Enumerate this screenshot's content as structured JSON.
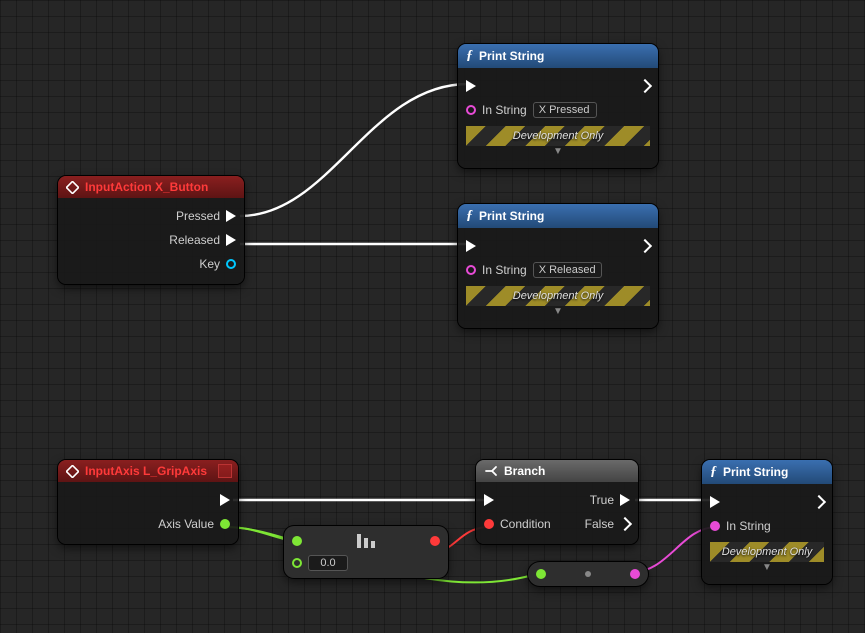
{
  "nodes": {
    "input_action": {
      "title": "InputAction X_Button",
      "pins": {
        "pressed": "Pressed",
        "released": "Released",
        "key": "Key"
      }
    },
    "print1": {
      "title": "Print String",
      "pins": {
        "in_string_label": "In String",
        "in_string_value": "X Pressed"
      },
      "footer": "Development Only"
    },
    "print2": {
      "title": "Print String",
      "pins": {
        "in_string_label": "In String",
        "in_string_value": "X Released"
      },
      "footer": "Development Only"
    },
    "input_axis": {
      "title": "InputAxis L_GripAxis",
      "pins": {
        "axis_value": "Axis Value"
      }
    },
    "compare": {
      "input_value": "0.0"
    },
    "branch": {
      "title": "Branch",
      "pins": {
        "condition": "Condition",
        "true": "True",
        "false": "False"
      }
    },
    "print3": {
      "title": "Print String",
      "pins": {
        "in_string_label": "In String"
      },
      "footer": "Development Only"
    }
  },
  "icons": {
    "event": "event-diamond-icon",
    "function": "function-f-icon",
    "branch": "branch-arrow-icon",
    "compare": "compare-bars-icon"
  }
}
